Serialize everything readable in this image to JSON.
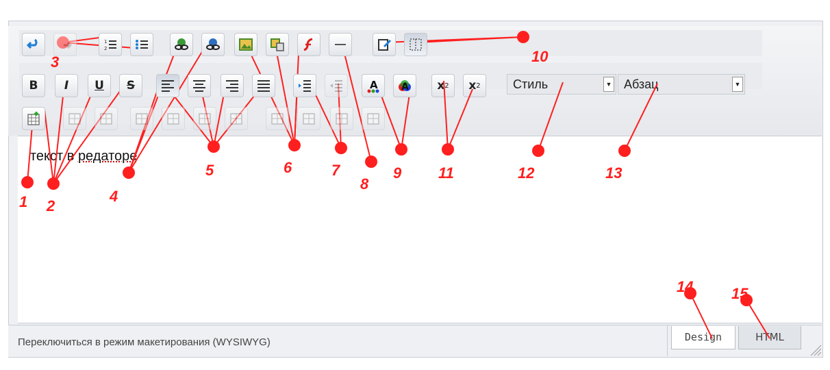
{
  "editor": {
    "toolbar": {
      "row1": [
        {
          "name": "undo-icon",
          "shape": "undo"
        },
        {
          "name": "redo-icon",
          "shape": "redo"
        },
        {
          "name": "ordered-list-icon",
          "shape": "ol"
        },
        {
          "name": "unordered-list-icon",
          "shape": "ul"
        },
        {
          "name": "insert-link-icon",
          "shape": "link"
        },
        {
          "name": "remove-link-icon",
          "shape": "unlink"
        },
        {
          "name": "insert-image-icon",
          "shape": "image"
        },
        {
          "name": "image-manager-icon",
          "shape": "image2"
        },
        {
          "name": "insert-flash-icon",
          "shape": "flash"
        },
        {
          "name": "horizontal-rule-icon",
          "shape": "hr"
        },
        {
          "name": "edit-source-icon",
          "shape": "edit"
        },
        {
          "name": "show-borders-icon",
          "shape": "borders"
        }
      ],
      "row2_format": [
        {
          "name": "bold-button",
          "label": "B"
        },
        {
          "name": "italic-button",
          "label": "I"
        },
        {
          "name": "underline-button",
          "label": "U"
        },
        {
          "name": "strikethrough-button",
          "label": "S"
        }
      ],
      "row2_icons": [
        {
          "name": "align-left-icon",
          "shape": "al"
        },
        {
          "name": "align-center-icon",
          "shape": "ac"
        },
        {
          "name": "align-right-icon",
          "shape": "ar"
        },
        {
          "name": "align-justify-icon",
          "shape": "aj"
        },
        {
          "name": "indent-icon",
          "shape": "indent"
        },
        {
          "name": "outdent-icon",
          "shape": "outdent"
        },
        {
          "name": "text-color-icon",
          "shape": "fg"
        },
        {
          "name": "background-color-icon",
          "shape": "bg"
        }
      ],
      "superscript": {
        "label": "x",
        "sup": "2"
      },
      "subscript": {
        "label": "x",
        "sub": "2"
      },
      "style_select": "Стиль",
      "paragraph_select": "Абзац",
      "row3": [
        {
          "name": "insert-table-icon",
          "shape": "table"
        },
        {
          "name": "table-properties-icon",
          "shape": "t"
        },
        {
          "name": "cell-properties-icon",
          "shape": "t"
        },
        {
          "name": "insert-row-before-icon",
          "shape": "t"
        },
        {
          "name": "insert-row-after-icon",
          "shape": "t"
        },
        {
          "name": "delete-row-icon",
          "shape": "t"
        },
        {
          "name": "insert-col-before-icon",
          "shape": "t"
        },
        {
          "name": "insert-col-after-icon",
          "shape": "t"
        },
        {
          "name": "delete-col-icon",
          "shape": "t"
        },
        {
          "name": "merge-cells-icon",
          "shape": "t"
        },
        {
          "name": "split-cell-icon",
          "shape": "t"
        }
      ]
    },
    "content_text_prefix": "текст в ",
    "content_text_word": "редаторе",
    "status_text": "Переключиться в режим макетирования (WYSIWYG)",
    "tabs": {
      "design": "Design",
      "html": "HTML"
    }
  },
  "annotations": [
    "1",
    "2",
    "3",
    "4",
    "5",
    "6",
    "7",
    "8",
    "9",
    "10",
    "11",
    "12",
    "13",
    "14",
    "15"
  ],
  "colors": {
    "marker": "#ff1f1f",
    "accent": "#1f7fd6"
  }
}
